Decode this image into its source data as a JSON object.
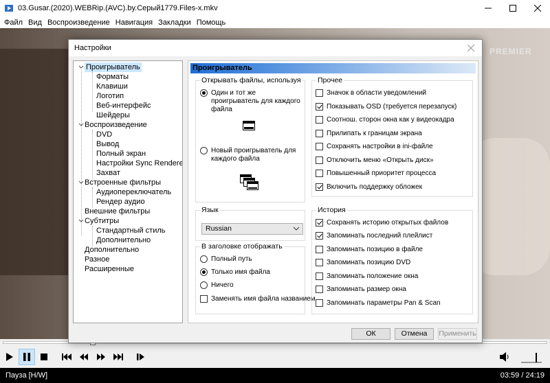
{
  "window": {
    "title": "03.Gusar.(2020).WEBRip.(AVC).by.Серый1779.Files-x.mkv",
    "controls": [
      "minimize-icon",
      "maximize-icon",
      "close-icon"
    ]
  },
  "menu": [
    "Файл",
    "Вид",
    "Воспроизведение",
    "Навигация",
    "Закладки",
    "Помощь"
  ],
  "video": {
    "watermark": "PREMIER"
  },
  "player": {
    "buttons": [
      "play-icon",
      "pause-icon",
      "stop-icon",
      "prev-icon",
      "rewind-icon",
      "forward-icon",
      "next-icon",
      "frame-step-icon"
    ],
    "active_button": "pause-icon",
    "status": "Пауза [H/W]",
    "time": "03:59 / 24:19"
  },
  "dialog": {
    "title": "Настройки",
    "tree": [
      {
        "label": "Проигрыватель",
        "level": 0,
        "expanded": true,
        "selected": true
      },
      {
        "label": "Форматы",
        "level": 1
      },
      {
        "label": "Клавиши",
        "level": 1
      },
      {
        "label": "Логотип",
        "level": 1
      },
      {
        "label": "Веб-интерфейс",
        "level": 1
      },
      {
        "label": "Шейдеры",
        "level": 1
      },
      {
        "label": "Воспроизведение",
        "level": 0,
        "expanded": true
      },
      {
        "label": "DVD",
        "level": 1
      },
      {
        "label": "Вывод",
        "level": 1
      },
      {
        "label": "Полный экран",
        "level": 1
      },
      {
        "label": "Настройки Sync Renderer",
        "level": 1
      },
      {
        "label": "Захват",
        "level": 1
      },
      {
        "label": "Встроенные фильтры",
        "level": 0,
        "expanded": true
      },
      {
        "label": "Аудиопереключатель",
        "level": 1
      },
      {
        "label": "Рендер аудио",
        "level": 1
      },
      {
        "label": "Внешние фильтры",
        "level": 0
      },
      {
        "label": "Субтитры",
        "level": 0,
        "expanded": true
      },
      {
        "label": "Стандартный стиль",
        "level": 1
      },
      {
        "label": "Дополнительно",
        "level": 1
      },
      {
        "label": "Дополнительно",
        "level": 0
      },
      {
        "label": "Разное",
        "level": 0
      },
      {
        "label": "Расширенные",
        "level": 0
      }
    ],
    "page_title": "Проигрыватель",
    "open_files": {
      "label": "Открывать файлы, используя",
      "options": [
        {
          "label": "Один и тот же проигрыватель для каждого файла",
          "checked": true
        },
        {
          "label": "Новый проигрыватель для каждого файла",
          "checked": false
        }
      ]
    },
    "language": {
      "label": "Язык",
      "value": "Russian"
    },
    "title_display": {
      "label": "В заголовке отображать",
      "options": [
        {
          "label": "Полный путь",
          "checked": false
        },
        {
          "label": "Только имя файла",
          "checked": true
        },
        {
          "label": "Ничего",
          "checked": false
        }
      ],
      "replace_name": {
        "label": "Заменять имя файла названием",
        "checked": false
      }
    },
    "other": {
      "label": "Прочее",
      "items": [
        {
          "label": "Значок в области уведомлений",
          "checked": false
        },
        {
          "label": "Показывать OSD (требуется перезапуск)",
          "checked": true
        },
        {
          "label": "Соотнош. сторон окна как у видеокадра",
          "checked": false
        },
        {
          "label": "Прилипать к границам экрана",
          "checked": false
        },
        {
          "label": "Сохранять настройки в ini-файле",
          "checked": false
        },
        {
          "label": "Отключить меню «Открыть диск»",
          "checked": false
        },
        {
          "label": "Повышенный приоритет процесса",
          "checked": false
        },
        {
          "label": "Включить поддержку обложек",
          "checked": true
        }
      ]
    },
    "history": {
      "label": "История",
      "items": [
        {
          "label": "Сохранять историю открытых файлов",
          "checked": true
        },
        {
          "label": "Запоминать последний плейлист",
          "checked": true
        },
        {
          "label": "Запоминать позицию в файле",
          "checked": false
        },
        {
          "label": "Запоминать позицию DVD",
          "checked": false
        },
        {
          "label": "Запоминать положение окна",
          "checked": false
        },
        {
          "label": "Запоминать размер окна",
          "checked": false
        },
        {
          "label": "Запоминать параметры Pan & Scan",
          "checked": false
        }
      ]
    },
    "buttons": {
      "ok": "ОК",
      "cancel": "Отмена",
      "apply": "Применить"
    }
  }
}
